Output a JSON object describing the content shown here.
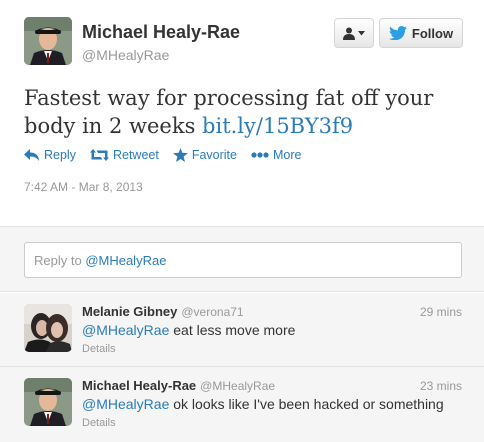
{
  "tweet": {
    "author_name": "Michael Healy-Rae",
    "author_handle": "@MHealyRae",
    "text": "Fastest way for processing fat off your body in 2 weeks ",
    "link": "bit.ly/15BY3f9",
    "timestamp": "7:42 AM - Mar 8, 2013",
    "follow_label": "Follow",
    "actions": {
      "reply": "Reply",
      "retweet": "Retweet",
      "favorite": "Favorite",
      "more": "More"
    }
  },
  "reply_box": {
    "prefix": "Reply to ",
    "mention": "@MHealyRae"
  },
  "replies": [
    {
      "name": "Melanie Gibney",
      "handle": "@verona71",
      "time": "29 mins",
      "mention": "@MHealyRae",
      "text": " eat less move more",
      "details": "Details"
    },
    {
      "name": "Michael Healy-Rae",
      "handle": "@MHealyRae",
      "time": "23 mins",
      "mention": "@MHealyRae",
      "text": " ok looks like I've been hacked or something",
      "details": "Details"
    }
  ],
  "colors": {
    "link": "#2a7cb8",
    "muted": "#999999",
    "background_alt": "#f5f5f5"
  },
  "icons": [
    "user-icon",
    "chevron-down-icon",
    "twitter-bird-icon",
    "reply-icon",
    "retweet-icon",
    "favorite-star-icon",
    "more-dots-icon"
  ]
}
